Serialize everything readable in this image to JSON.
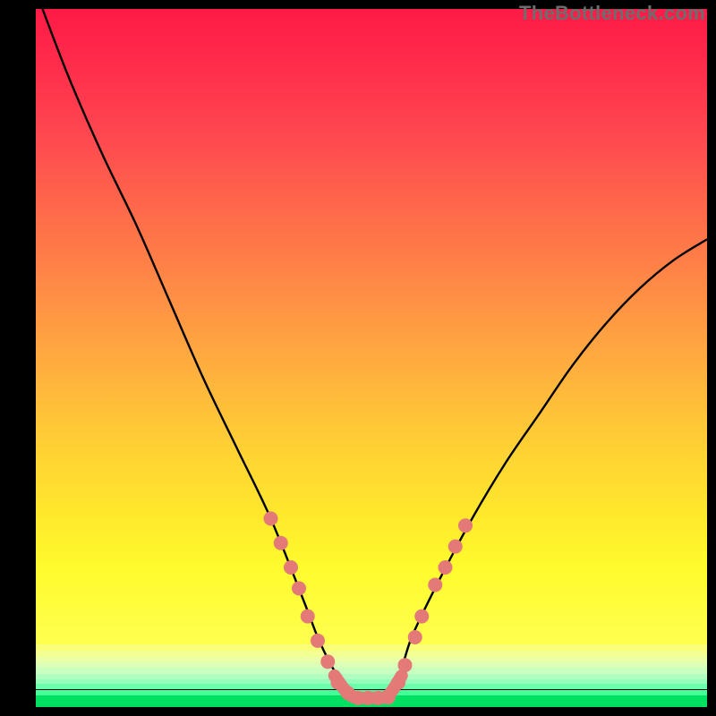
{
  "watermark": "TheBottleneck.com",
  "chart_data": {
    "type": "line",
    "title": "",
    "xlabel": "",
    "ylabel": "",
    "xlim": [
      0,
      100
    ],
    "ylim": [
      0,
      100
    ],
    "background_gradient": {
      "top": "#ff1a47",
      "bottom": "#00e060"
    },
    "bands": [
      {
        "top_pct": 91.0,
        "height_pct": 0.9,
        "color": "#faff77"
      },
      {
        "top_pct": 91.9,
        "height_pct": 0.9,
        "color": "#f3ff92"
      },
      {
        "top_pct": 92.8,
        "height_pct": 0.8,
        "color": "#e9ffa8"
      },
      {
        "top_pct": 93.6,
        "height_pct": 0.8,
        "color": "#dbffb6"
      },
      {
        "top_pct": 94.4,
        "height_pct": 0.8,
        "color": "#c9ffbf"
      },
      {
        "top_pct": 95.2,
        "height_pct": 0.8,
        "color": "#b0ffc0"
      },
      {
        "top_pct": 96.0,
        "height_pct": 0.7,
        "color": "#93ffba"
      },
      {
        "top_pct": 96.7,
        "height_pct": 0.8,
        "color": "#6cffab"
      },
      {
        "top_pct": 97.5,
        "height_pct": 0.8,
        "color": "#44ff98"
      },
      {
        "top_pct": 98.3,
        "height_pct": 1.7,
        "color": "#00e060"
      }
    ],
    "series": [
      {
        "name": "bottleneck-curve",
        "color": "#000000",
        "x": [
          1,
          5,
          10,
          15,
          20,
          25,
          30,
          35,
          40,
          42,
          44,
          46,
          48,
          50,
          52,
          54,
          56,
          60,
          65,
          70,
          75,
          80,
          85,
          90,
          95,
          100
        ],
        "y": [
          100,
          90,
          79,
          69,
          58,
          47,
          37,
          27,
          15,
          10,
          6,
          3,
          1.4,
          1.3,
          1.4,
          4,
          10,
          18,
          27,
          35,
          42,
          49,
          55,
          60,
          64,
          67
        ]
      }
    ],
    "markers": {
      "name": "highlighted-points",
      "color": "#e47a78",
      "radius": 8,
      "points": [
        {
          "x": 35,
          "y": 27
        },
        {
          "x": 36.5,
          "y": 23.5
        },
        {
          "x": 38,
          "y": 20
        },
        {
          "x": 39.2,
          "y": 17
        },
        {
          "x": 40.5,
          "y": 13
        },
        {
          "x": 42,
          "y": 9.5
        },
        {
          "x": 43.5,
          "y": 6.5
        },
        {
          "x": 45,
          "y": 3.5
        },
        {
          "x": 46.5,
          "y": 2
        },
        {
          "x": 48,
          "y": 1.3
        },
        {
          "x": 49.5,
          "y": 1.3
        },
        {
          "x": 51,
          "y": 1.3
        },
        {
          "x": 52.5,
          "y": 1.4
        },
        {
          "x": 54,
          "y": 3.5
        },
        {
          "x": 55,
          "y": 6
        },
        {
          "x": 56.5,
          "y": 10
        },
        {
          "x": 57.5,
          "y": 13
        },
        {
          "x": 59.5,
          "y": 17.5
        },
        {
          "x": 61,
          "y": 20
        },
        {
          "x": 62.5,
          "y": 23
        },
        {
          "x": 64,
          "y": 26
        }
      ]
    },
    "bottom_segment": {
      "name": "valley-stroke",
      "color": "#e47a78",
      "stroke_width": 14,
      "x": [
        44.5,
        46,
        47,
        48,
        49,
        50,
        51,
        52,
        53,
        54.5
      ],
      "y": [
        4.5,
        2.5,
        1.6,
        1.3,
        1.3,
        1.3,
        1.3,
        1.4,
        2.2,
        4.5
      ]
    }
  }
}
